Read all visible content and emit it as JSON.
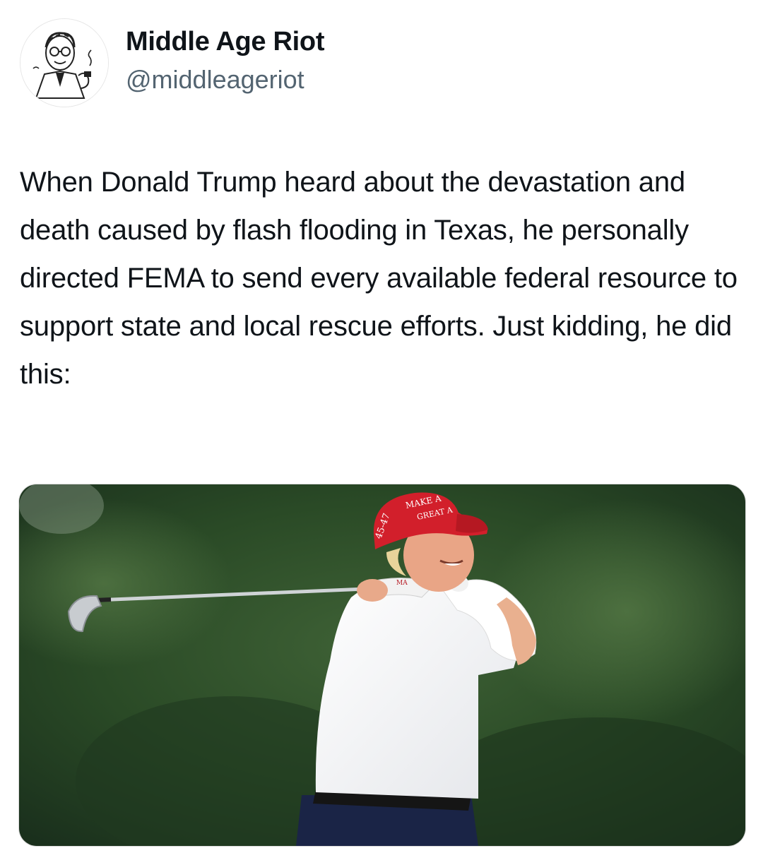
{
  "author": {
    "display_name": "Middle Age Riot",
    "handle": "@middleageriot",
    "avatar_icon": "cartoon-man-with-pipe-avatar"
  },
  "post": {
    "text": "When Donald Trump heard about the devastation and death caused by flash flooding in Texas, he personally directed FEMA to send every available federal resource to support state and local rescue efforts. Just kidding, he did this:",
    "image": {
      "subject": "golfer-in-red-cap-mid-swing",
      "cap_text_line1": "MAKE A",
      "cap_text_line2": "GREAT A",
      "cap_side_text": "45-47",
      "collar_text": "MA"
    }
  },
  "colors": {
    "text_primary": "#0f1419",
    "text_secondary": "#536471",
    "cap_red": "#d21f2b",
    "foliage_dark": "#1f3a1e"
  }
}
